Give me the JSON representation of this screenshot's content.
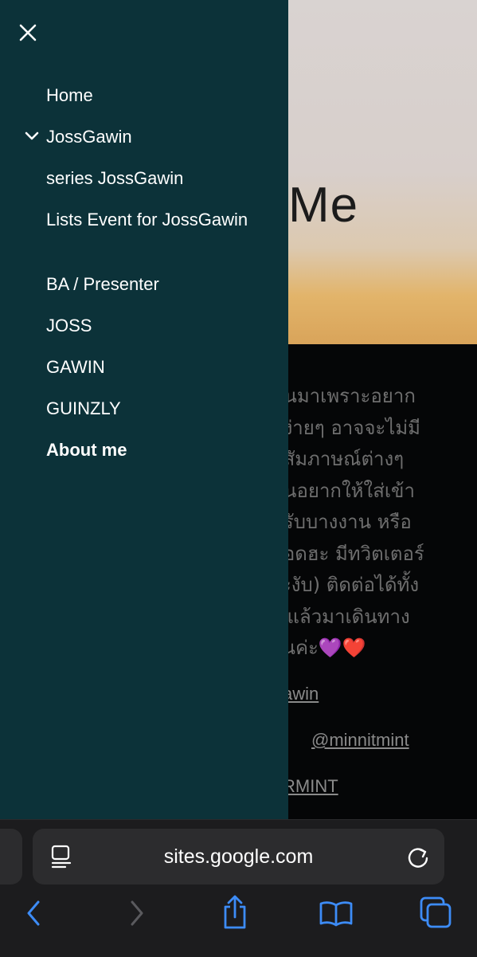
{
  "page": {
    "hero_title": "Me",
    "paragraph_lines": [
      "ขึ้นมาเพราะอยาก",
      "ดูง่ายๆ อาจจะไม่มี",
      "ต์สัมภาษณ์ต่างๆ",
      "คนอยากให้ใส่เข้า",
      "หรับบางงาน หรือ",
      "ทอดฮะ มีทวิตเตอร์",
      "ระงับ) ติดต่อได้ทั้ง",
      "ะ แล้วมาเดินทาง",
      "กันค่ะ"
    ],
    "hearts": "💜❤️",
    "links": [
      "awin",
      "@minnitmint",
      "RMINT"
    ]
  },
  "drawer": {
    "items": [
      {
        "label": "Home",
        "expanded": false
      },
      {
        "label": "JossGawin",
        "expanded": true
      },
      {
        "label": "series JossGawin"
      },
      {
        "label": "Lists Event for JossGawin"
      },
      {
        "label": "BA / Presenter"
      },
      {
        "label": "JOSS"
      },
      {
        "label": "GAWIN"
      },
      {
        "label": "GUINZLY"
      },
      {
        "label": "About me",
        "active": true
      }
    ]
  },
  "browser": {
    "url": "sites.google.com"
  },
  "colors": {
    "drawer_bg": "#0c3239",
    "toolbar_bg": "#1c1c1e",
    "accent_blue": "#3d8cf7"
  },
  "icons": {
    "close": "close-icon",
    "chevron": "chevron-down-icon",
    "reader": "reader-icon",
    "reload": "reload-icon",
    "back": "back-icon",
    "forward": "forward-icon",
    "share": "share-icon",
    "bookmarks": "bookmarks-icon",
    "tabs": "tabs-icon"
  }
}
